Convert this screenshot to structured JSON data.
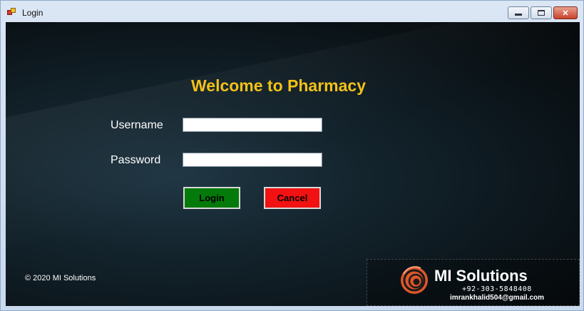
{
  "window": {
    "title": "Login",
    "icon": "app-window-icon",
    "controls": {
      "minimize": "minimize-icon",
      "maximize": "maximize-icon",
      "close": "✕"
    }
  },
  "form": {
    "heading": "Welcome to Pharmacy",
    "username_label": "Username",
    "username_value": "",
    "password_label": "Password",
    "password_value": "",
    "login_label": "Login",
    "cancel_label": "Cancel"
  },
  "footer": {
    "copyright": "© 2020 MI Solutions"
  },
  "brand": {
    "name": "MI Solutions",
    "phone": "+92-303-5848408",
    "email": "imrankhalid504@gmail.com",
    "logo_icon": "mi-solutions-logo"
  },
  "colors": {
    "heading": "#f2c217",
    "login_button": "#047a0a",
    "cancel_button": "#f21212",
    "logo_orange": "#e0562a"
  }
}
